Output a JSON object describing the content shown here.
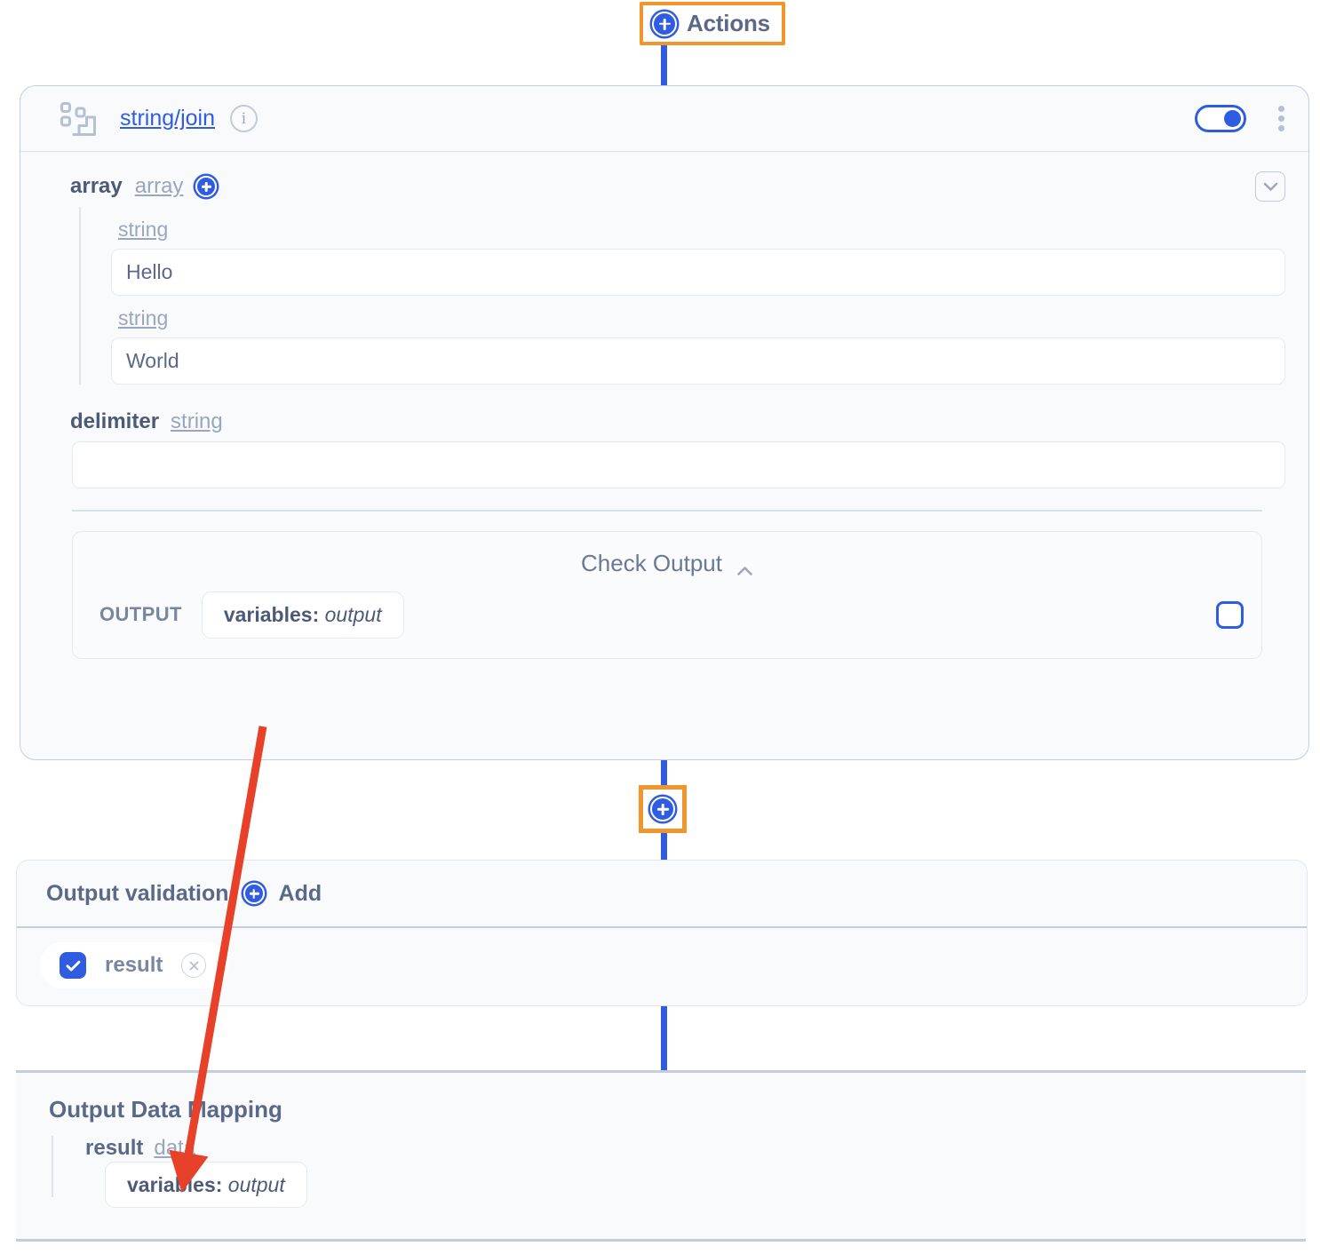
{
  "top_node": {
    "label": "Actions",
    "icon": "plus-circle-icon"
  },
  "action_card": {
    "module_icon": "modules-icon",
    "title": "string/join",
    "info_icon": "info-icon",
    "info_glyph": "i",
    "toggle": {
      "name": "enabled-toggle",
      "state": "on"
    },
    "menu_icon": "kebab-menu-icon",
    "fields": {
      "array": {
        "name": "array",
        "type": "array",
        "add_icon": "plus-circle-icon",
        "collapse_icon": "chevron-down-icon",
        "items": [
          {
            "type": "string",
            "value": "Hello"
          },
          {
            "type": "string",
            "value": "World"
          }
        ]
      },
      "delimiter": {
        "name": "delimiter",
        "type": "string",
        "value": "",
        "placeholder": ""
      }
    },
    "check_output": {
      "title": "Check Output",
      "collapse_icon": "chevron-up-icon",
      "output_label": "OUTPUT",
      "output_pill": {
        "key": "variables:",
        "value": "output"
      },
      "checkbox": {
        "name": "check-output-checkbox",
        "checked": false
      }
    }
  },
  "mid_node": {
    "icon": "plus-circle-icon"
  },
  "output_validation": {
    "title": "Output validation",
    "add_icon": "plus-circle-icon",
    "add_label": "Add",
    "items": [
      {
        "label": "result",
        "checked": true,
        "remove_icon": "circle-x-icon"
      }
    ]
  },
  "output_data_mapping": {
    "title": "Output Data Mapping",
    "field": {
      "name": "result",
      "type": "data"
    },
    "pill": {
      "key": "variables:",
      "value": "output"
    }
  },
  "colors": {
    "accent_blue": "#2f5ce0",
    "highlight_orange": "#f0962c",
    "annotation_red": "#e8412a",
    "text_slate": "#5b6887",
    "muted": "#9aa6bc",
    "card_bg": "#f8fafc"
  },
  "annotation": {
    "type": "arrow",
    "color": "#e8412a",
    "from": "check-output-variables-pill",
    "to": "output-data-mapping-variables-pill"
  }
}
